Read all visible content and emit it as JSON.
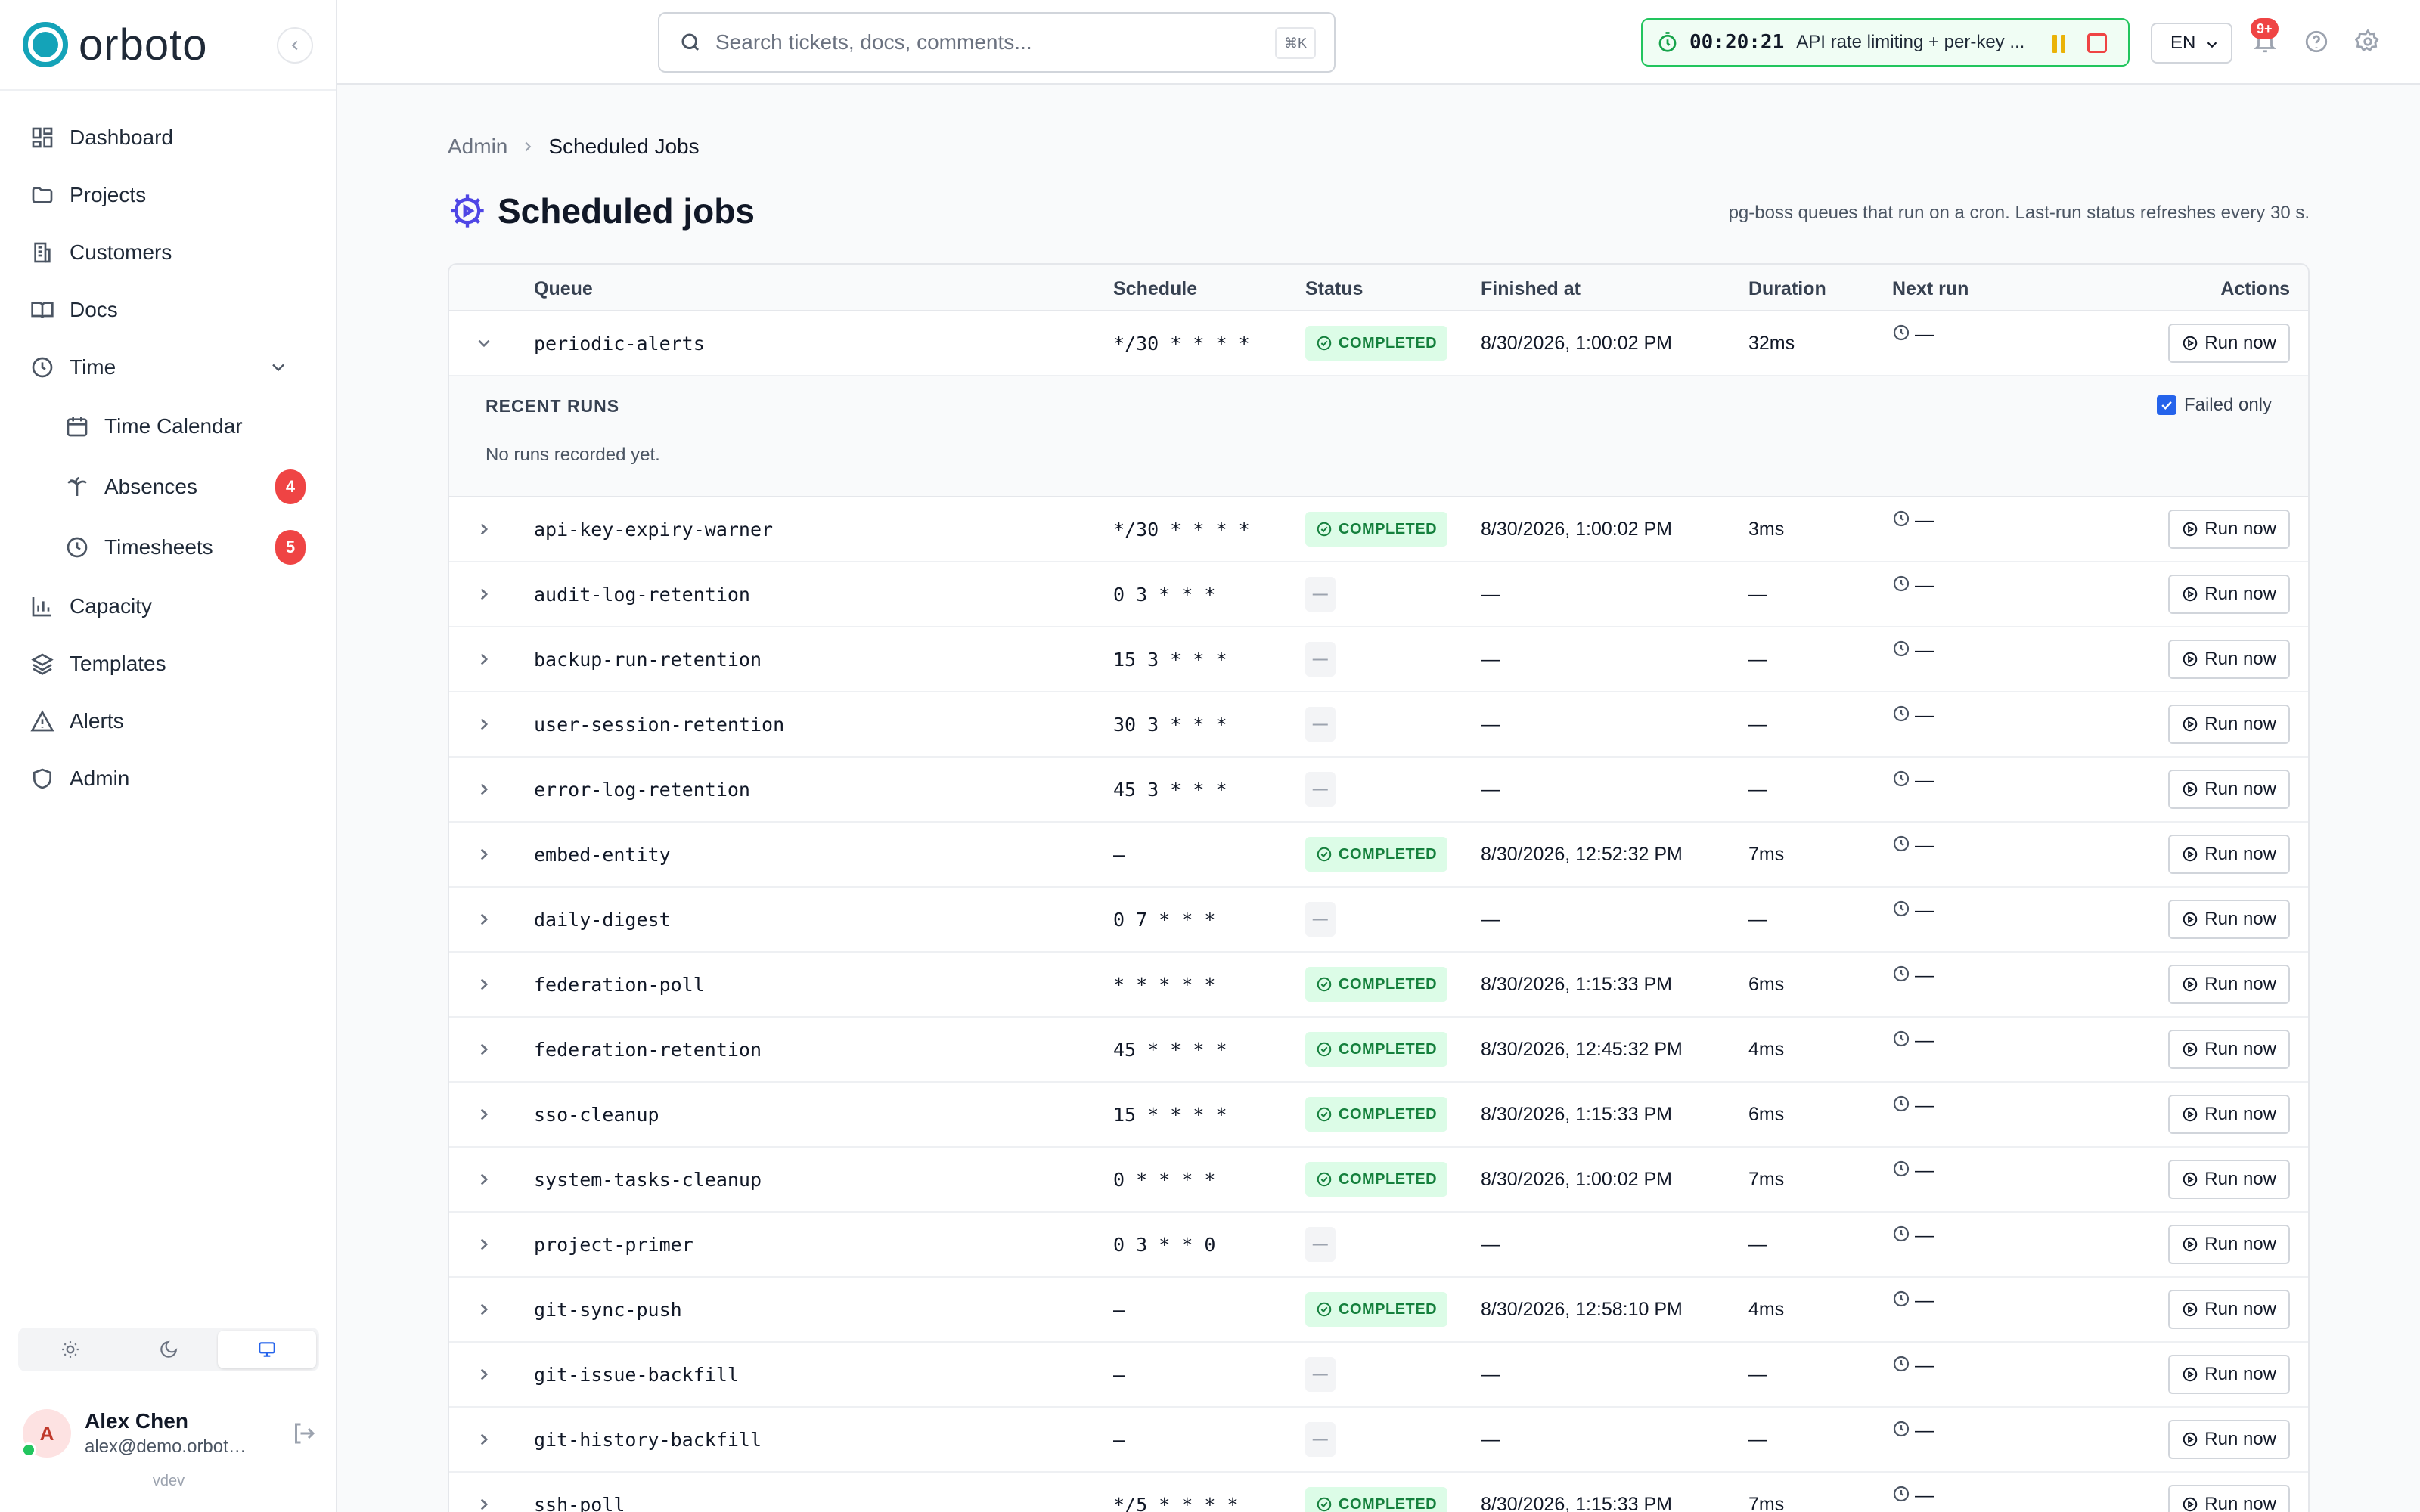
{
  "brand": {
    "name": "orboto"
  },
  "sidebar": {
    "items": [
      {
        "label": "Dashboard",
        "icon": "dashboard-icon"
      },
      {
        "label": "Projects",
        "icon": "folder-icon"
      },
      {
        "label": "Customers",
        "icon": "building-icon"
      },
      {
        "label": "Docs",
        "icon": "book-icon"
      },
      {
        "label": "Time",
        "icon": "clock-icon",
        "expanded": true
      },
      {
        "label": "Time Calendar",
        "icon": "calendar-icon",
        "sub": true
      },
      {
        "label": "Absences",
        "icon": "palm-tree-icon",
        "sub": true,
        "badge": "4"
      },
      {
        "label": "Timesheets",
        "icon": "clock-icon",
        "sub": true,
        "badge": "5"
      },
      {
        "label": "Capacity",
        "icon": "bar-chart-icon"
      },
      {
        "label": "Templates",
        "icon": "layers-icon"
      },
      {
        "label": "Alerts",
        "icon": "warning-icon"
      },
      {
        "label": "Admin",
        "icon": "shield-icon"
      }
    ],
    "theme": {
      "options": [
        "light",
        "dark",
        "system"
      ],
      "selected": "system"
    },
    "user": {
      "initial": "A",
      "name": "Alex Chen",
      "email": "alex@demo.orbot…",
      "status_color": "#22c55e"
    },
    "env": "vdev"
  },
  "topbar": {
    "search": {
      "placeholder": "Search tickets, docs, comments...",
      "shortcut": "⌘K"
    },
    "timer": {
      "time": "00:20:21",
      "task": "API rate limiting + per-key ..."
    },
    "language": "EN",
    "notifications_badge": "9+"
  },
  "breadcrumb": {
    "root": "Admin",
    "current": "Scheduled Jobs"
  },
  "page": {
    "title": "Scheduled jobs",
    "description": "pg-boss queues that run on a cron. Last-run status refreshes every 30 s."
  },
  "table": {
    "columns": {
      "queue": "Queue",
      "schedule": "Schedule",
      "status": "Status",
      "finished_at": "Finished at",
      "duration": "Duration",
      "next_run": "Next run",
      "actions": "Actions"
    },
    "run_now_label": "Run now",
    "recent_runs": {
      "title": "RECENT RUNS",
      "empty": "No runs recorded yet.",
      "failed_only_label": "Failed only",
      "failed_only_checked": true
    },
    "rows": [
      {
        "queue": "periodic-alerts",
        "schedule": "*/30 * * * *",
        "status": "COMPLETED",
        "finished_at": "8/30/2026, 1:00:02 PM",
        "duration": "32ms",
        "next_run": "—",
        "expanded": true
      },
      {
        "queue": "api-key-expiry-warner",
        "schedule": "*/30 * * * *",
        "status": "COMPLETED",
        "finished_at": "8/30/2026, 1:00:02 PM",
        "duration": "3ms",
        "next_run": "—"
      },
      {
        "queue": "audit-log-retention",
        "schedule": "0 3 * * *",
        "status": "—",
        "finished_at": "—",
        "duration": "—",
        "next_run": "—"
      },
      {
        "queue": "backup-run-retention",
        "schedule": "15 3 * * *",
        "status": "—",
        "finished_at": "—",
        "duration": "—",
        "next_run": "—"
      },
      {
        "queue": "user-session-retention",
        "schedule": "30 3 * * *",
        "status": "—",
        "finished_at": "—",
        "duration": "—",
        "next_run": "—"
      },
      {
        "queue": "error-log-retention",
        "schedule": "45 3 * * *",
        "status": "—",
        "finished_at": "—",
        "duration": "—",
        "next_run": "—"
      },
      {
        "queue": "embed-entity",
        "schedule": "—",
        "status": "COMPLETED",
        "finished_at": "8/30/2026, 12:52:32 PM",
        "duration": "7ms",
        "next_run": "—"
      },
      {
        "queue": "daily-digest",
        "schedule": "0 7 * * *",
        "status": "—",
        "finished_at": "—",
        "duration": "—",
        "next_run": "—"
      },
      {
        "queue": "federation-poll",
        "schedule": "* * * * *",
        "status": "COMPLETED",
        "finished_at": "8/30/2026, 1:15:33 PM",
        "duration": "6ms",
        "next_run": "—"
      },
      {
        "queue": "federation-retention",
        "schedule": "45 * * * *",
        "status": "COMPLETED",
        "finished_at": "8/30/2026, 12:45:32 PM",
        "duration": "4ms",
        "next_run": "—"
      },
      {
        "queue": "sso-cleanup",
        "schedule": "15 * * * *",
        "status": "COMPLETED",
        "finished_at": "8/30/2026, 1:15:33 PM",
        "duration": "6ms",
        "next_run": "—"
      },
      {
        "queue": "system-tasks-cleanup",
        "schedule": "0 * * * *",
        "status": "COMPLETED",
        "finished_at": "8/30/2026, 1:00:02 PM",
        "duration": "7ms",
        "next_run": "—"
      },
      {
        "queue": "project-primer",
        "schedule": "0 3 * * 0",
        "status": "—",
        "finished_at": "—",
        "duration": "—",
        "next_run": "—"
      },
      {
        "queue": "git-sync-push",
        "schedule": "—",
        "status": "COMPLETED",
        "finished_at": "8/30/2026, 12:58:10 PM",
        "duration": "4ms",
        "next_run": "—"
      },
      {
        "queue": "git-issue-backfill",
        "schedule": "—",
        "status": "—",
        "finished_at": "—",
        "duration": "—",
        "next_run": "—"
      },
      {
        "queue": "git-history-backfill",
        "schedule": "—",
        "status": "—",
        "finished_at": "—",
        "duration": "—",
        "next_run": "—"
      },
      {
        "queue": "ssh-poll",
        "schedule": "*/5 * * * *",
        "status": "COMPLETED",
        "finished_at": "8/30/2026, 1:15:33 PM",
        "duration": "7ms",
        "next_run": "—"
      }
    ]
  },
  "colors": {
    "brand": "#14a3b8",
    "accent": "#2563eb",
    "success": "#15803d",
    "danger": "#ef4444",
    "timer_border": "#22c55e"
  }
}
